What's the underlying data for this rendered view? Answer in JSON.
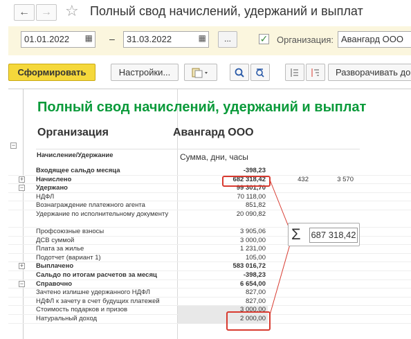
{
  "window": {
    "title": "Полный свод начислений, удержаний и выплат",
    "back_icon": "←",
    "forward_icon": "→",
    "favorite_icon": "☆"
  },
  "filters": {
    "date_from": "01.01.2022",
    "date_to": "31.03.2022",
    "dash": "–",
    "period_button": "...",
    "org_checked": true,
    "org_label": "Организация:",
    "org_value": "Авангард ООО"
  },
  "toolbar": {
    "generate_label": "Сформировать",
    "settings_label": "Настройки...",
    "expand_label": "Разворачивать до"
  },
  "report": {
    "title": "Полный свод начислений, удержаний и выплат",
    "org_label": "Организация",
    "org_value": "Авангард ООО",
    "header_left": "Начисление/Удержание",
    "header_right": "Сумма, дни, часы",
    "rows": [
      {
        "label": "Входящее сальдо месяца",
        "value": "-398,23",
        "bold": true
      },
      {
        "label": "Начислено",
        "value": "682 318,42",
        "v2": "432",
        "v3": "3 570",
        "bold": true,
        "expander": true
      },
      {
        "label": "Удержано",
        "value": "99 301,70",
        "bold": true,
        "expander": true
      },
      {
        "label": "НДФЛ",
        "value": "70 118,00"
      },
      {
        "label": "Вознаграждение платежного агента",
        "value": "851,82"
      },
      {
        "label": "Удержание по исполнительному документу",
        "value": "20 090,82",
        "multi": true
      },
      {
        "label": "Профсоюзные взносы",
        "value": "3 905,06"
      },
      {
        "label": "ДСВ суммой",
        "value": "3 000,00"
      },
      {
        "label": "Плата за жилье",
        "value": "1 231,00"
      },
      {
        "label": "Подотчет (вариант 1)",
        "value": "105,00"
      },
      {
        "label": "Выплачено",
        "value": "583 016,72",
        "bold": true,
        "expander": true
      },
      {
        "label": "Сальдо по итогам расчетов за месяц",
        "value": "-398,23",
        "bold": true
      },
      {
        "label": "Справочно",
        "value": "6 654,00",
        "bold": true,
        "expander": true
      },
      {
        "label": "Зачтено излишне удержанного НДФЛ",
        "value": "827,00"
      },
      {
        "label": "НДФЛ к зачету в счет будущих платежей",
        "value": "827,00"
      },
      {
        "label": "Стоимость подарков и призов",
        "value": "3 000,00",
        "grey": true
      },
      {
        "label": "Натуральный доход",
        "value": "2 000,00",
        "grey": true
      }
    ]
  },
  "sum_popup": {
    "sigma": "Σ",
    "value": "687 318,42"
  },
  "colors": {
    "title_green": "#0a9a3a",
    "highlight_red": "#d83a2f",
    "filter_bg": "#fbf6de",
    "generate_yellow": "#f5d83b"
  }
}
